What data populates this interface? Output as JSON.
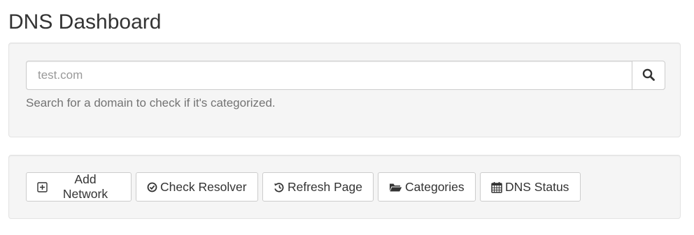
{
  "page": {
    "title": "DNS Dashboard"
  },
  "search": {
    "placeholder": "test.com",
    "value": "",
    "help": "Search for a domain to check if it's categorized.",
    "button_icon": "search-icon"
  },
  "actions": [
    {
      "label": "Add Network",
      "icon": "plus-square-icon"
    },
    {
      "label": "Check Resolver",
      "icon": "check-circle-icon"
    },
    {
      "label": "Refresh Page",
      "icon": "history-icon"
    },
    {
      "label": "Categories",
      "icon": "folder-open-icon"
    },
    {
      "label": "DNS Status",
      "icon": "calendar-icon"
    }
  ]
}
